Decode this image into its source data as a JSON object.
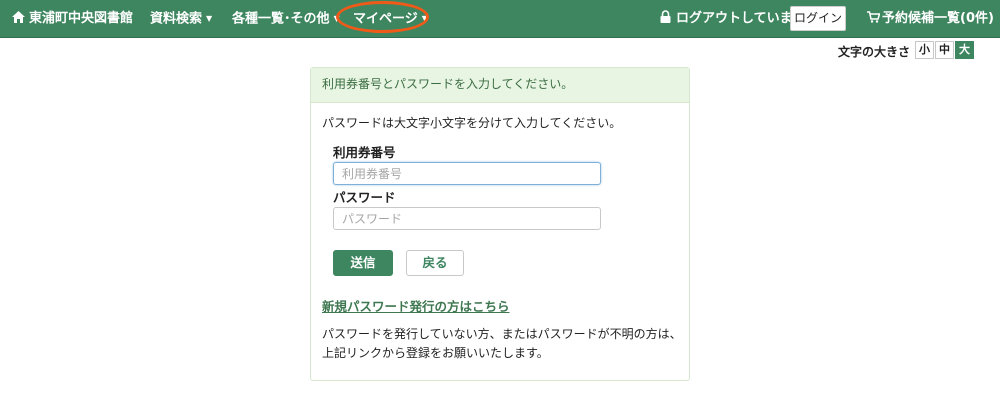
{
  "header": {
    "site_title": "東浦町中央図書館",
    "menu_search": "資料検索",
    "menu_list": "各種一覧･その他",
    "menu_mypage": "マイページ",
    "logout_status": "ログアウトしています",
    "login_button": "ログイン",
    "reservation_cart": "予約候補一覧(0件)"
  },
  "font_size": {
    "label": "文字の大きさ",
    "options": [
      "小",
      "中",
      "大"
    ],
    "selected": "大"
  },
  "login_panel": {
    "heading": "利用券番号とパスワードを入力してください。",
    "instruction": "パスワードは大文字小文字を分けて入力してください。",
    "card_number_label": "利用券番号",
    "card_number_placeholder": "利用券番号",
    "card_number_value": "",
    "password_label": "パスワード",
    "password_placeholder": "パスワード",
    "password_value": "",
    "submit_button": "送信",
    "back_button": "戻る",
    "new_password_link": "新規パスワード発行の方はこちら",
    "note_line1": "パスワードを発行していない方、またはパスワードが不明の方は、",
    "note_line2": "上記リンクから登録をお願いいたします。"
  },
  "colors": {
    "brand_green": "#3e8660",
    "heading_bg": "#e7f5e2",
    "highlight_ring": "#f05a19"
  },
  "icons": [
    "home-icon",
    "lock-icon",
    "cart-icon",
    "chevron-down-icon"
  ]
}
